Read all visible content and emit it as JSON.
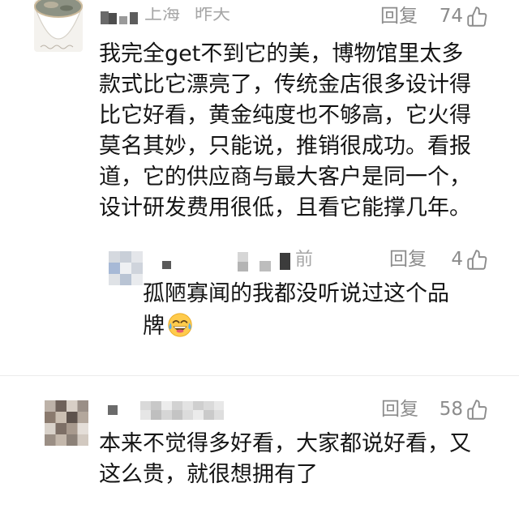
{
  "colors": {
    "background": "#ffffff",
    "text": "#141414",
    "meta": "#8c8c8c",
    "location_time": "#a6a6a6",
    "divider": "#ececec"
  },
  "icons": {
    "like": "thumbs-up-icon",
    "reply_emoji": "face-with-tears-of-joy"
  },
  "comment_1": {
    "location": "上海",
    "time": "昨天",
    "reply_label": "回复",
    "like_count": 74,
    "lines": [
      "我完全get不到它的美，博物馆里太多",
      "款式比它漂亮了，传统金店很多设计得",
      "比它好看，黄金纯度也不够高，它火得",
      "莫名其妙，只能说，推销很成功。看报",
      "道，它的供应商与最大客户是同一个，",
      "设计研发费用很低，且看它能撑几年。"
    ]
  },
  "reply_1": {
    "time": "前",
    "reply_label": "回复",
    "like_count": 4,
    "lines": [
      "孤陋寡闻的我都没听说过这个品",
      "牌"
    ],
    "emoji": "face-with-tears-of-joy"
  },
  "comment_2": {
    "reply_label": "回复",
    "like_count": 58,
    "lines": [
      "本来不觉得多好看，大家都说好看，又",
      "这么贵，就很想拥有了"
    ]
  }
}
